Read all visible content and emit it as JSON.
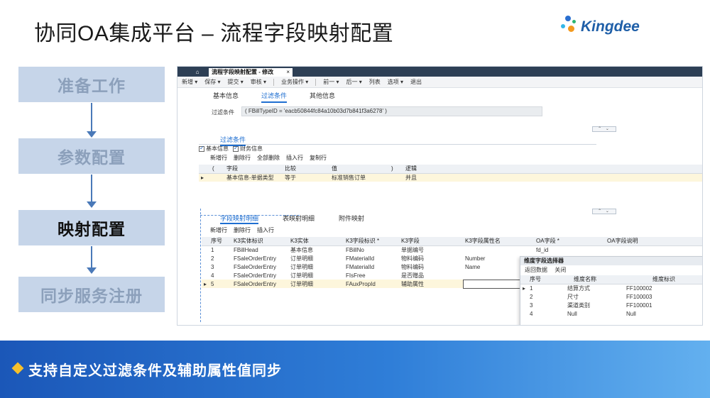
{
  "slide": {
    "title": "协同OA集成平台 – 流程字段映射配置",
    "logo_text": "Kingdee",
    "banner_text": "支持自定义过滤条件及辅助属性值同步"
  },
  "steps": [
    {
      "label": "准备工作",
      "state": "inactive"
    },
    {
      "label": "参数配置",
      "state": "inactive"
    },
    {
      "label": "映射配置",
      "state": "active"
    },
    {
      "label": "同步服务注册",
      "state": "inactive"
    }
  ],
  "app": {
    "home_icon": "home-icon",
    "doc_tab": "流程字段映射配置 - 修改",
    "doc_tab_close": "×",
    "toolbar": [
      "新增 ▾",
      "保存 ▾",
      "提交 ▾",
      "审核 ▾",
      "业务操作 ▾",
      "前一 ▾",
      "后一 ▾",
      "列表",
      "选项 ▾",
      "退出"
    ],
    "subtabs": [
      "基本信息",
      "过滤条件",
      "其他信息"
    ],
    "filter_label": "过滤条件",
    "filter_value": "( FBillTypeID = 'eacb50844fc84a10b03d7b841f3a6278' )",
    "pager": "⌃ ⌄",
    "filter_section": {
      "title": "过滤条件",
      "checks": [
        "基本信息",
        "财务信息"
      ],
      "tools": [
        "新增行",
        "删除行",
        "全部删除",
        "插入行",
        "复制行"
      ],
      "headers": [
        "(",
        "字段",
        "比较",
        "值",
        ")",
        "逻辑"
      ],
      "rows": [
        {
          "marker": "▸",
          "lp": "",
          "field": "基本信息-单据类型",
          "op": "等于",
          "value": "标准销售订单",
          "rp": "",
          "logic": "并且"
        }
      ]
    },
    "mapping_section": {
      "tabs": [
        "字段映射明细",
        "表映射明细",
        "附件映射"
      ],
      "tools": [
        "新增行",
        "删除行",
        "插入行"
      ],
      "headers": [
        "序号",
        "K3实体标识",
        "K3实体",
        "K3字段标识 *",
        "K3字段",
        "K3字段属性名",
        "OA字段 *",
        "OA字段说明"
      ],
      "rows": [
        {
          "seq": "1",
          "entity_id": "FBillHead",
          "entity": "基本信息",
          "field_id": "FBillNo",
          "field": "单据编号",
          "prop": "",
          "oa": "fd_id",
          "oa_desc": ""
        },
        {
          "seq": "2",
          "entity_id": "FSaleOrderEntry",
          "entity": "订单明细",
          "field_id": "FMaterialId",
          "field": "物料编码",
          "prop": "Number",
          "oa": "",
          "oa_desc": ""
        },
        {
          "seq": "3",
          "entity_id": "FSaleOrderEntry",
          "entity": "订单明细",
          "field_id": "FMaterialId",
          "field": "物料编码",
          "prop": "Name",
          "oa": "",
          "oa_desc": ""
        },
        {
          "seq": "4",
          "entity_id": "FSaleOrderEntry",
          "entity": "订单明细",
          "field_id": "FIsFree",
          "field": "是否赠品",
          "prop": "",
          "oa": "",
          "oa_desc": ""
        },
        {
          "seq": "5",
          "entity_id": "FSaleOrderEntry",
          "entity": "订单明细",
          "field_id": "FAuxPropId",
          "field": "辅助属性",
          "prop": "",
          "oa": "",
          "oa_desc": ""
        }
      ]
    },
    "picker": {
      "title": "维度字段选择器",
      "tools": [
        "返回数据",
        "关闭"
      ],
      "headers": [
        "序号",
        "维度名称",
        "维度标识"
      ],
      "rows": [
        {
          "marker": "▸",
          "seq": "1",
          "name": "结算方式",
          "id": "FF100002"
        },
        {
          "marker": "",
          "seq": "2",
          "name": "尺寸",
          "id": "FF100003"
        },
        {
          "marker": "",
          "seq": "3",
          "name": "渠道类别",
          "id": "FF100001"
        },
        {
          "marker": "",
          "seq": "4",
          "name": "Null",
          "id": "Null"
        }
      ]
    }
  }
}
